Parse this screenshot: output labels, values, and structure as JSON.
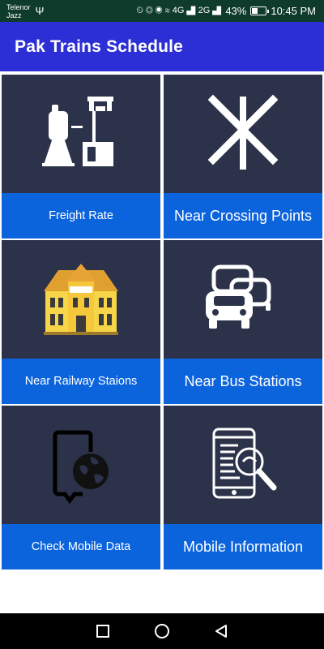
{
  "status_bar": {
    "carrier_line1": "Telenor",
    "carrier_line2": "Jazz",
    "usb_glyph": "Ψ",
    "signal_icons": "⏲ ◎ ◉ ≋ 4G ▟ 2G ▟",
    "battery_percent": "43%",
    "time": "10:45 PM",
    "background_color": "#0e3b2b"
  },
  "app_bar": {
    "title": "Pak Trains Schedule",
    "background_color": "#2d2fd6"
  },
  "tiles": [
    {
      "label": "Freight Rate",
      "icon": "water-tower-icon"
    },
    {
      "label": "Near Crossing Points",
      "icon": "railway-crossing-icon"
    },
    {
      "label": "Near Railway Staions",
      "icon": "railway-station-building-icon"
    },
    {
      "label": "Near Bus Stations",
      "icon": "buses-icon"
    },
    {
      "label": "Check Mobile Data",
      "icon": "phone-globe-icon"
    },
    {
      "label": "Mobile Information",
      "icon": "phone-search-icon"
    }
  ],
  "colors": {
    "tile_background": "#2b3249",
    "tile_label_background": "#0c64dd",
    "nav_bar": "#000000"
  },
  "nav_bar": {
    "buttons": [
      "recent-apps-icon",
      "home-icon",
      "back-icon"
    ]
  }
}
